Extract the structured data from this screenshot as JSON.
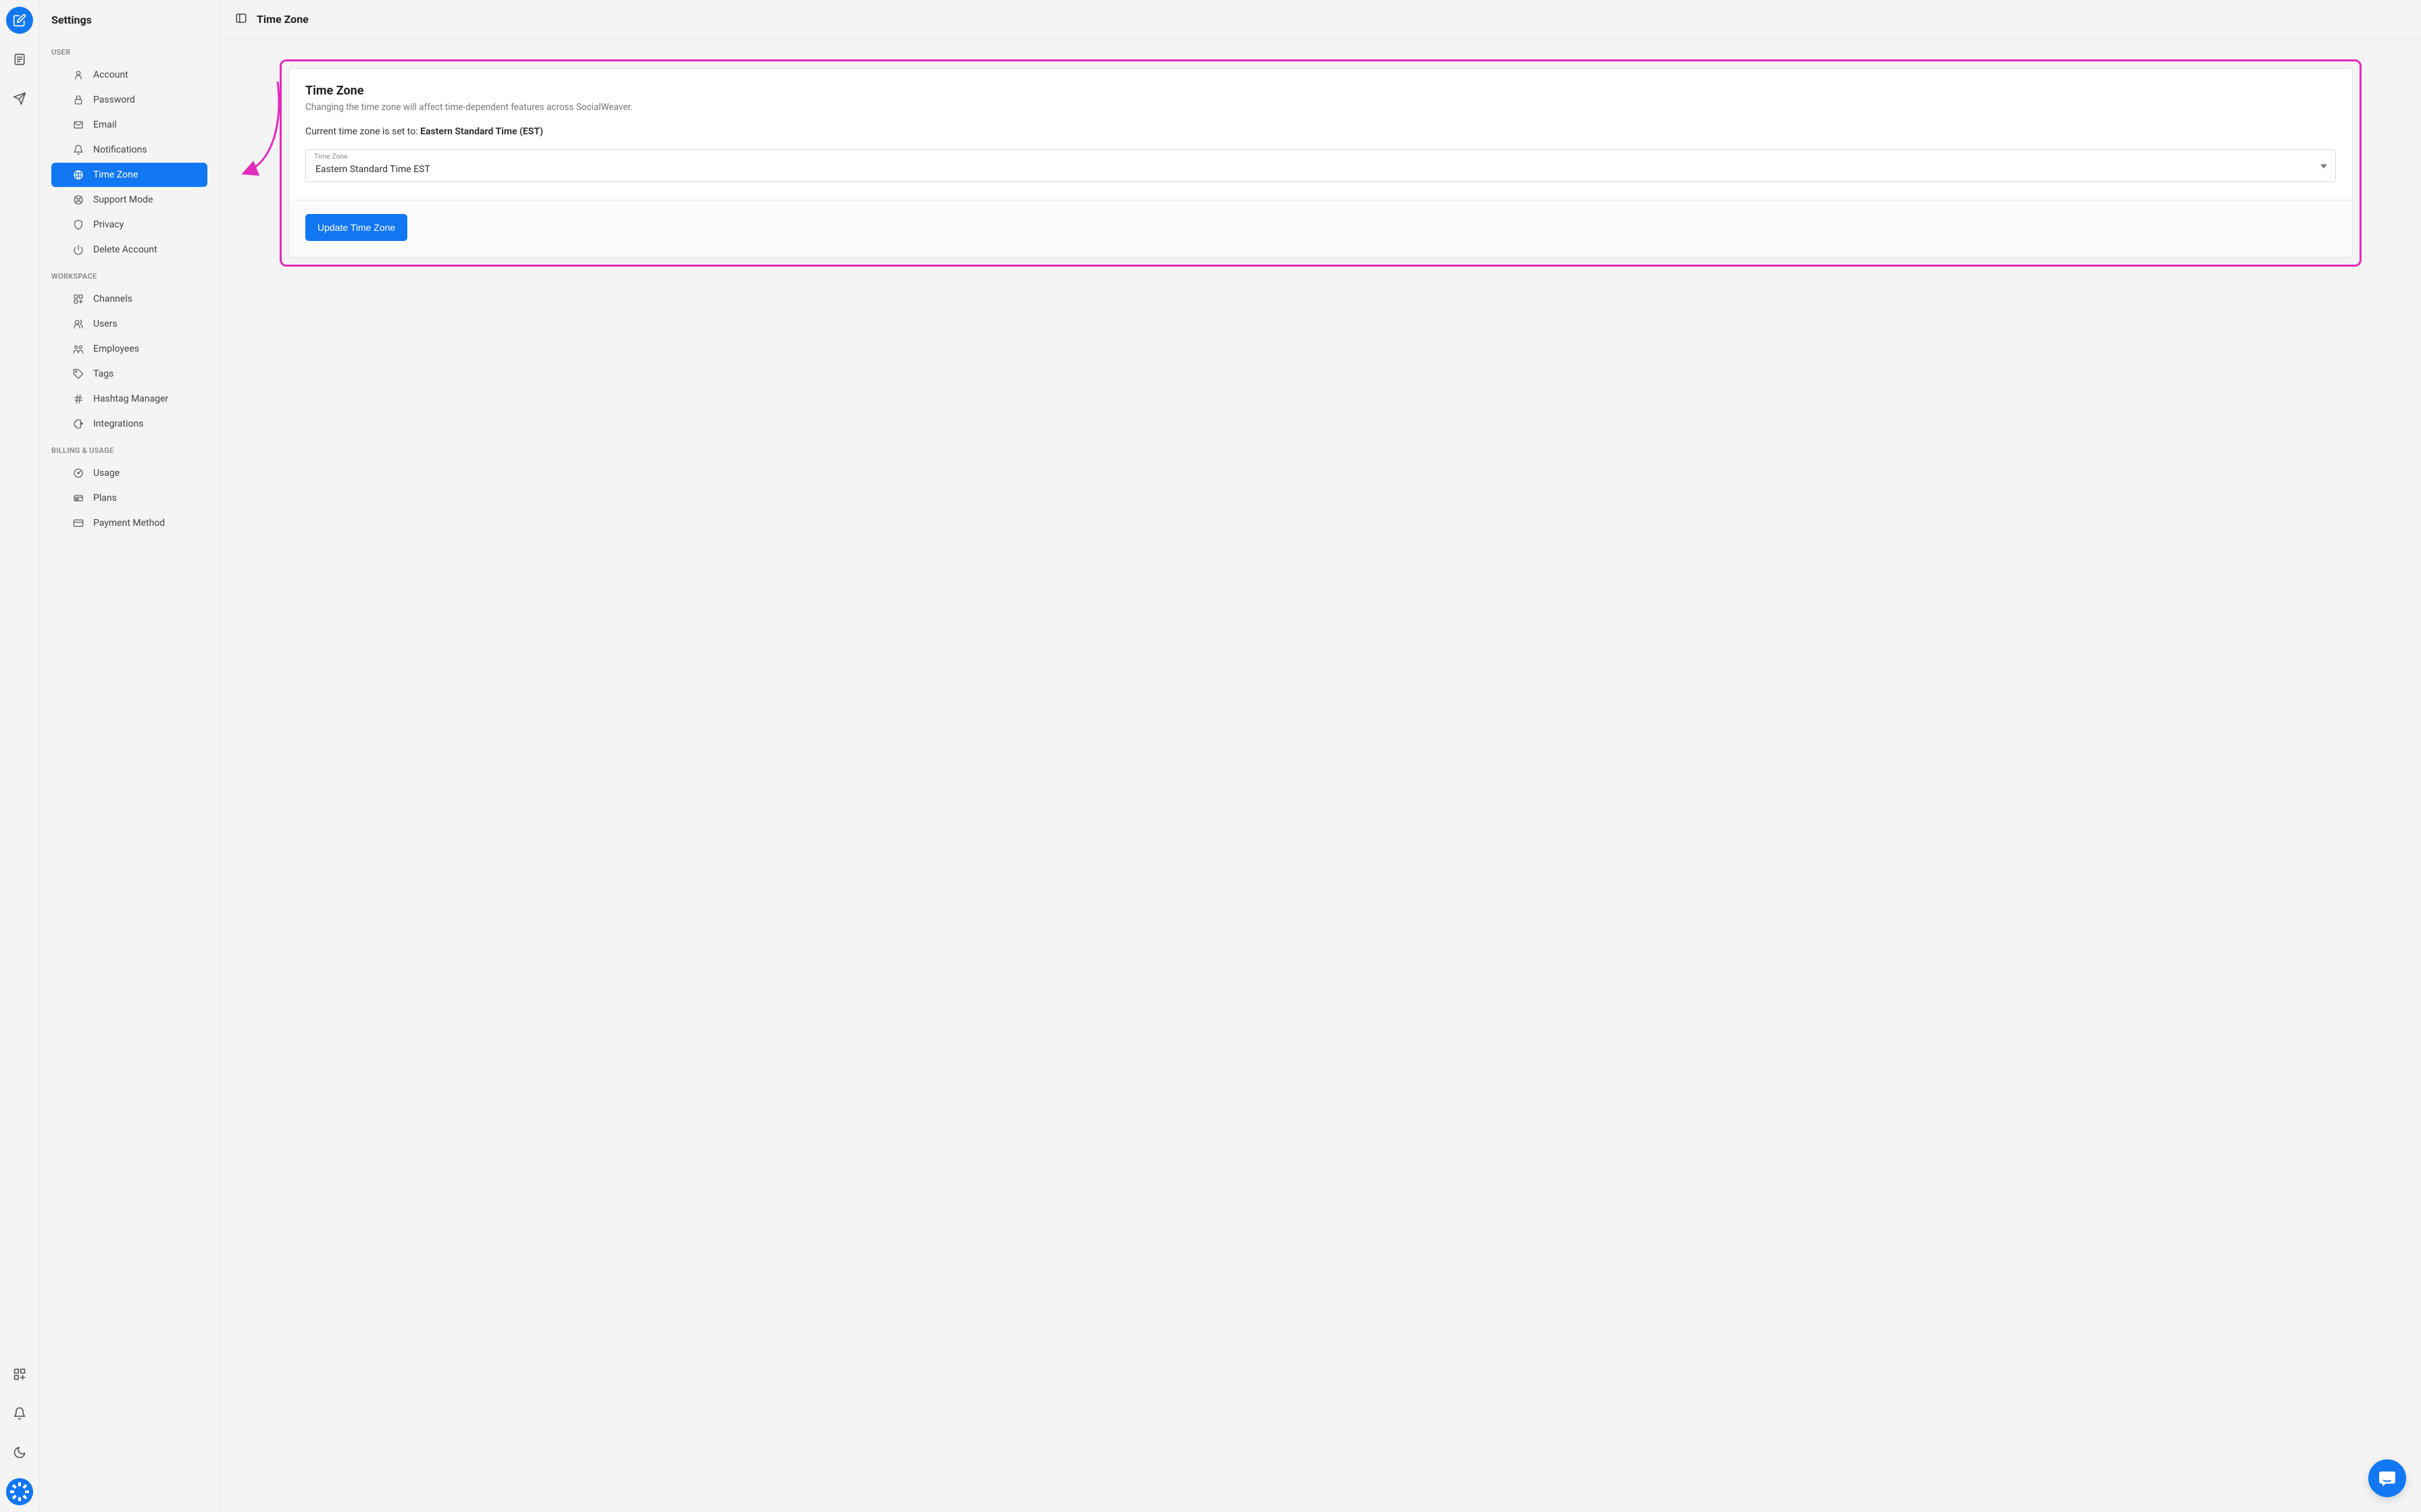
{
  "sidebar_title": "Settings",
  "topbar_title": "Time Zone",
  "sections": {
    "user": {
      "label": "USER",
      "items": [
        {
          "label": "Account",
          "icon": "user-icon"
        },
        {
          "label": "Password",
          "icon": "lock-icon"
        },
        {
          "label": "Email",
          "icon": "mail-icon"
        },
        {
          "label": "Notifications",
          "icon": "bell-icon"
        },
        {
          "label": "Time Zone",
          "icon": "globe-icon",
          "active": true
        },
        {
          "label": "Support Mode",
          "icon": "support-icon"
        },
        {
          "label": "Privacy",
          "icon": "shield-icon"
        },
        {
          "label": "Delete Account",
          "icon": "power-icon"
        }
      ]
    },
    "workspace": {
      "label": "WORKSPACE",
      "items": [
        {
          "label": "Channels",
          "icon": "grid-add-icon"
        },
        {
          "label": "Users",
          "icon": "users-icon"
        },
        {
          "label": "Employees",
          "icon": "employees-icon"
        },
        {
          "label": "Tags",
          "icon": "tag-icon"
        },
        {
          "label": "Hashtag Manager",
          "icon": "hash-icon"
        },
        {
          "label": "Integrations",
          "icon": "puzzle-icon"
        }
      ]
    },
    "billing": {
      "label": "BILLING & USAGE",
      "items": [
        {
          "label": "Usage",
          "icon": "gauge-icon"
        },
        {
          "label": "Plans",
          "icon": "plans-icon"
        },
        {
          "label": "Payment Method",
          "icon": "card-icon"
        }
      ]
    }
  },
  "timezone_card": {
    "title": "Time Zone",
    "subtitle": "Changing the time zone will affect time-dependent features across SocialWeaver.",
    "current_prefix": "Current time zone is set to: ",
    "current_value": "Eastern Standard Time (EST)",
    "select_label": "Time Zone",
    "select_value": "Eastern Standard Time EST",
    "button": "Update Time Zone"
  }
}
